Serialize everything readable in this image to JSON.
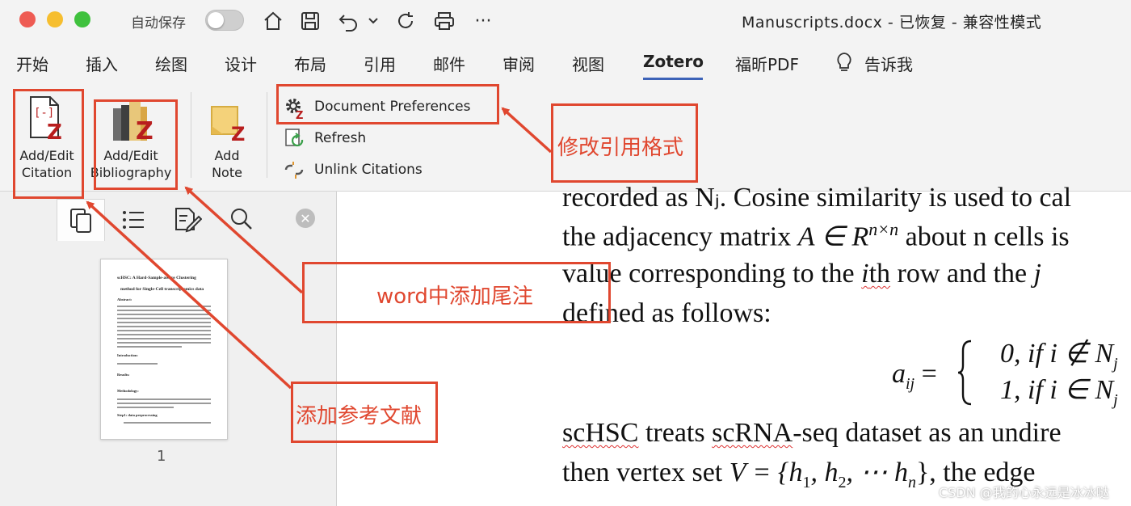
{
  "titlebar": {
    "autosave_label": "自动保存",
    "document_title": "Manuscripts.docx - 已恢复 - 兼容性模式",
    "colors": {
      "close": "#ee5b53",
      "minimize": "#f6be2f",
      "maximize": "#3fc13d"
    }
  },
  "menu": {
    "tabs": [
      "开始",
      "插入",
      "绘图",
      "设计",
      "布局",
      "引用",
      "邮件",
      "审阅",
      "视图",
      "Zotero",
      "福昕PDF",
      "告诉我"
    ],
    "active_tab": "Zotero"
  },
  "ribbon": {
    "add_citation": [
      "Add/Edit",
      "Citation"
    ],
    "add_bibliography": [
      "Add/Edit",
      "Bibliography"
    ],
    "add_note": [
      "Add",
      "Note"
    ],
    "doc_prefs": "Document Preferences",
    "refresh": "Refresh",
    "unlink": "Unlink Citations"
  },
  "sidebar": {
    "page_number": "1",
    "thumbnail": {
      "title_line1": "scHSC: A Hard-Sample-aware Clustering",
      "title_line2": "method for Single-Cell transcriptomics data",
      "section_abstract": "Abstract:",
      "section_intro": "Introduction:",
      "section_results": "Results:",
      "section_methods": "Methodology:",
      "section_preprocess": "Step1: data preprocessing"
    }
  },
  "document": {
    "line1": "recorded as Nⱼ. Cosine similarity is used to cal",
    "line2_a": "the adjacency matrix ",
    "line2_math": "A ∈ R",
    "line2_sup": "n×n",
    "line2_b": " about n cells is",
    "line3_a": "value corresponding to the ",
    "line3_ith": "i",
    "line3_th": "th",
    "line3_b": " row and the ",
    "line3_j": "j",
    "line4": "defined as follows:",
    "eq_lhs": "a",
    "eq_lhs_sub": "ij",
    "eq_eq": "=",
    "eq_row1": "0, if  i  ∉  N",
    "eq_row1_sub": "j",
    "eq_row2": "1, if  i  ∈  N",
    "eq_row2_sub": "j",
    "line5_a": "scHSC",
    "line5_b": " treats ",
    "line5_c": "scRNA",
    "line5_d": "-seq dataset as an undire",
    "line6_a": "then vertex set ",
    "line6_math": "V = {h",
    "line6_b": ", h",
    "line6_c": ", ⋯ h",
    "line6_d": "}, the edge",
    "line6_sub1": "1",
    "line6_sub2": "2",
    "line6_sub3": "n"
  },
  "annotations": {
    "citation_style": "修改引用格式",
    "endnote": "word中添加尾注",
    "add_references": "添加参考文献",
    "color": "#e0472f"
  },
  "watermark": "CSDN @我的心永远是冰冰哒"
}
